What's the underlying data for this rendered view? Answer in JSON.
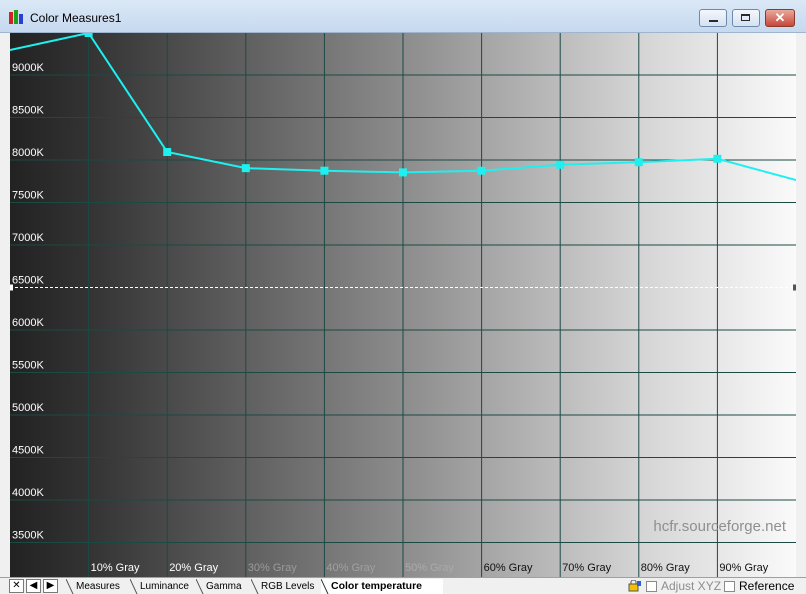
{
  "window": {
    "title": "Color Measures1",
    "buttons": [
      "minimize",
      "maximize",
      "close"
    ]
  },
  "chart_data": {
    "type": "line",
    "title": "",
    "y_unit_suffix": "K",
    "y_ticks": [
      3500,
      4000,
      4500,
      5000,
      5500,
      6000,
      6500,
      7000,
      7500,
      8000,
      8500,
      9000
    ],
    "y_tick_labels": [
      "3500K",
      "4000K",
      "4500K",
      "5000K",
      "5500K",
      "6000K",
      "6500K",
      "7000K",
      "7500K",
      "8000K",
      "8500K",
      "9000K"
    ],
    "ylim": [
      3000,
      9400
    ],
    "x_tick_labels": [
      "10% Gray",
      "20% Gray",
      "30% Gray",
      "40% Gray",
      "50% Gray",
      "60% Gray",
      "70% Gray",
      "80% Gray",
      "90% Gray"
    ],
    "x": [
      0,
      10,
      20,
      30,
      40,
      50,
      60,
      70,
      80,
      90,
      100
    ],
    "xlim": [
      0,
      100
    ],
    "series": [
      {
        "color": "#1ef0f0",
        "values": [
          9200,
          9400,
          8000,
          7810,
          7780,
          7760,
          7780,
          7850,
          7880,
          7920,
          7670
        ]
      }
    ],
    "reference_line": {
      "value": 6500,
      "style": "dashed",
      "color": "#ffffff"
    },
    "grid": true,
    "background": "gray gradient from dark (left) to white (right)",
    "grid_color": "#1b4a44",
    "watermark": "hcfr.sourceforge.net"
  },
  "tabs": {
    "nav_icons": [
      "close-icon",
      "arrow-left-icon",
      "arrow-right-icon"
    ],
    "nav_glyphs": [
      "✕",
      "◀",
      "▶"
    ],
    "items": [
      "Measures",
      "Luminance",
      "Gamma",
      "RGB Levels",
      "Color temperature"
    ],
    "active": "Color temperature"
  },
  "status": {
    "adjust_xyz_label": "Adjust XYZ",
    "reference_label": "Reference"
  }
}
